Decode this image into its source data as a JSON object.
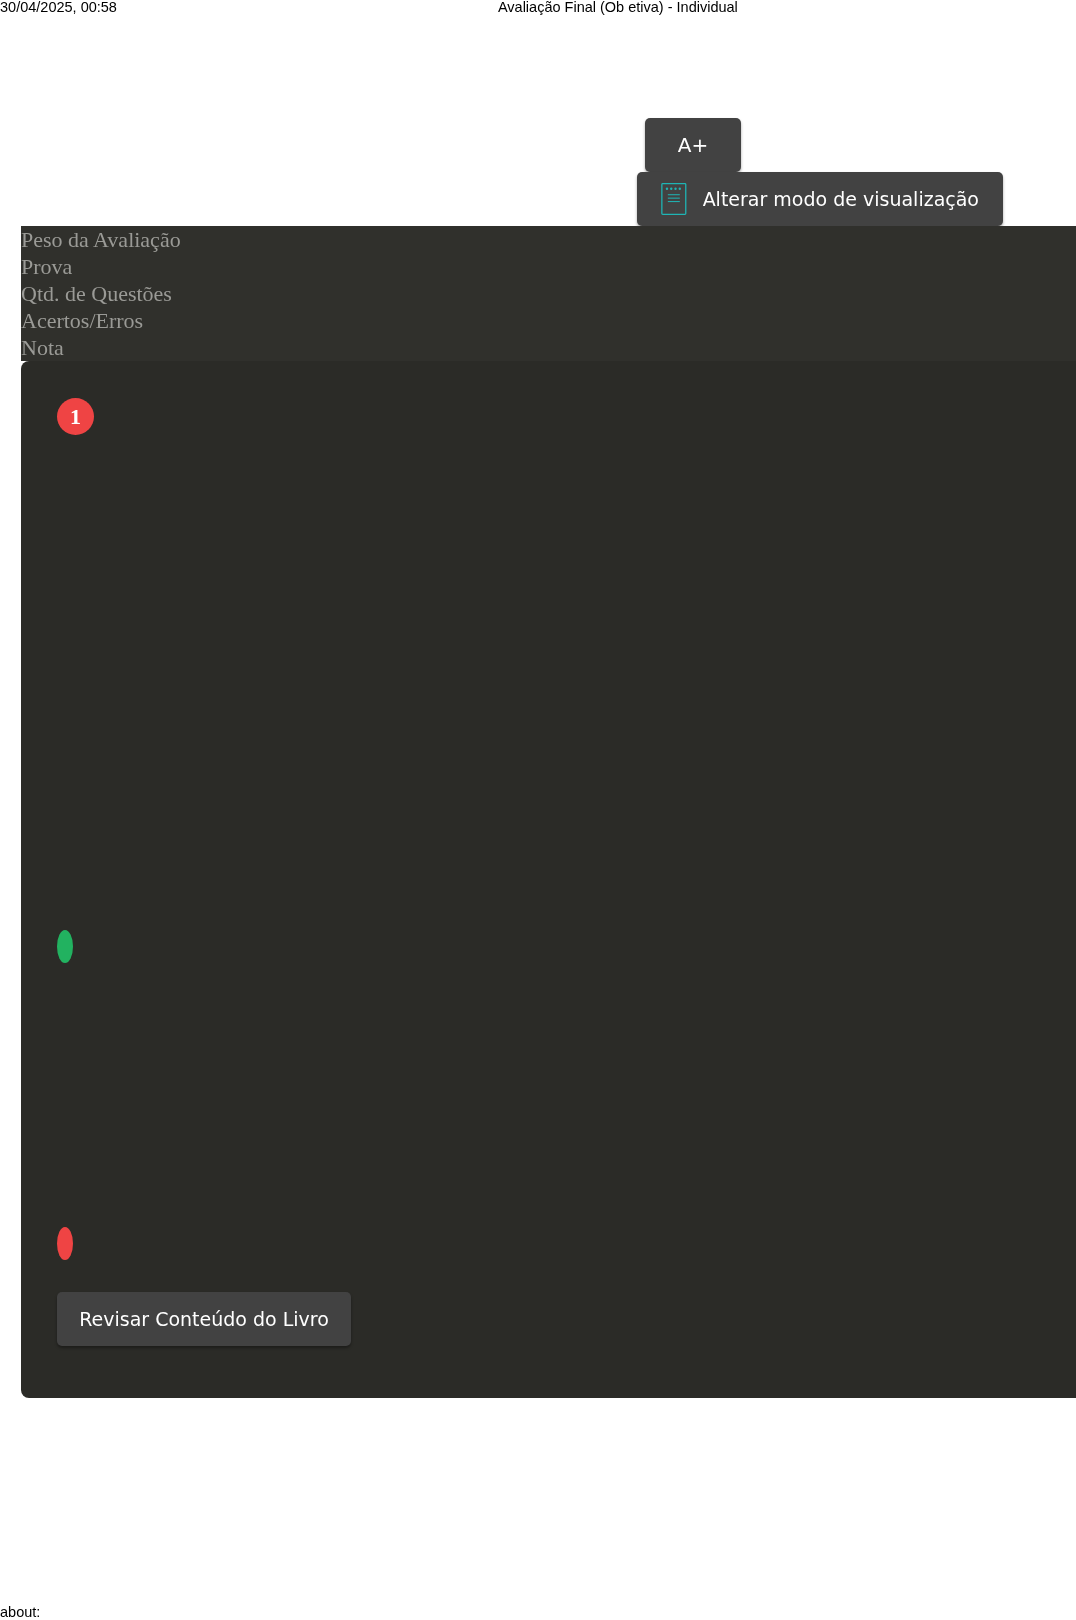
{
  "print_header": {
    "date": "30/04/2025, 00:58",
    "title": "Avaliação Final (Ob etiva) - Individual"
  },
  "toolbar": {
    "font_button": "A+",
    "view_mode_button": "Alterar modo de visualização"
  },
  "info_labels": [
    "Peso da Avaliação",
    "Prova",
    "Qtd. de Questões",
    "Acertos/Erros",
    "Nota"
  ],
  "question": {
    "number": "1",
    "color": "#ef4444",
    "markers": [
      {
        "color": "#22b260"
      },
      {
        "color": "#ef4444"
      }
    ]
  },
  "review_button": "Revisar Conteúdo do Livro",
  "print_footer": "about:"
}
